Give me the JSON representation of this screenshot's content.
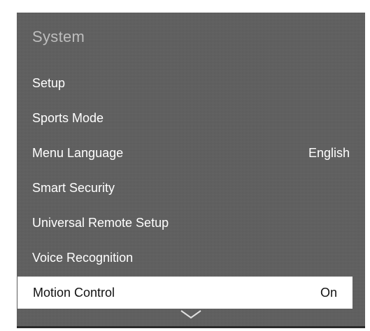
{
  "panel": {
    "title": "System"
  },
  "menu": {
    "items": [
      {
        "label": "Setup",
        "value": ""
      },
      {
        "label": "Sports Mode",
        "value": ""
      },
      {
        "label": "Menu Language",
        "value": "English"
      },
      {
        "label": "Smart Security",
        "value": ""
      },
      {
        "label": "Universal Remote Setup",
        "value": ""
      },
      {
        "label": "Voice Recognition",
        "value": ""
      },
      {
        "label": "Motion Control",
        "value": "On",
        "selected": true
      }
    ]
  },
  "icons": {
    "scroll_down": "chevron-down-icon"
  },
  "colors": {
    "panel_background": "#5f5f5f",
    "title_text": "#bdbdbd",
    "item_text": "#ffffff",
    "selected_background": "#ffffff",
    "selected_text": "#111111"
  }
}
